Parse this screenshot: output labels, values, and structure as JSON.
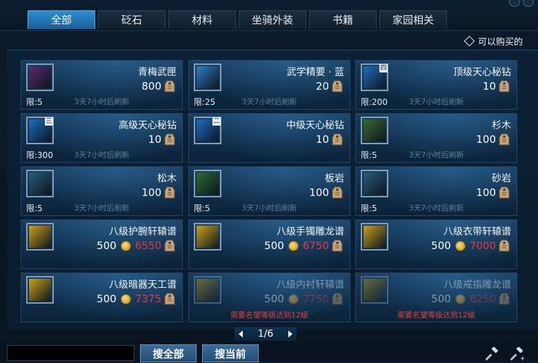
{
  "tabs": [
    "全部",
    "砭石",
    "材料",
    "坐骑外装",
    "书籍",
    "家园相关"
  ],
  "filter_label": "可以购买的",
  "pager": "1/6",
  "buttons": {
    "search_all": "搜全部",
    "search_current": "搜当前"
  },
  "items": [
    {
      "name": "青梅武匣",
      "price": "800",
      "limit": "限:5",
      "refresh": "3天7小时后刷新",
      "icon": "box-icon",
      "color": "#5b2b6e",
      "badge": ""
    },
    {
      "name": "武学精要 · 蓝",
      "price": "20",
      "limit": "限:25",
      "refresh": "3天7小时后刷新",
      "icon": "scroll-icon",
      "color": "#2f7fc4",
      "badge": ""
    },
    {
      "name": "顶级天心秘钻",
      "price": "10",
      "limit": "限:200",
      "refresh": "3天7小时后刷新",
      "icon": "gem-icon",
      "color": "#1e6ec0",
      "badge": "四"
    },
    {
      "name": "高级天心秘钻",
      "price": "10",
      "limit": "限:300",
      "refresh": "3天7小时后刷新",
      "icon": "gem-icon",
      "color": "#1e6ec0",
      "badge": "三"
    },
    {
      "name": "中级天心秘钻",
      "price": "10",
      "limit": "",
      "refresh": "",
      "icon": "gem-icon",
      "color": "#1e6ec0",
      "badge": "二"
    },
    {
      "name": "杉木",
      "price": "100",
      "limit": "限:5",
      "refresh": "3天7小时后刷新",
      "icon": "wood-icon",
      "color": "#3c6a2e",
      "badge": ""
    },
    {
      "name": "松木",
      "price": "100",
      "limit": "限:5",
      "refresh": "3天7小时后刷新",
      "icon": "wood-icon",
      "color": "#2a5d7c",
      "badge": ""
    },
    {
      "name": "板岩",
      "price": "100",
      "limit": "限:5",
      "refresh": "3天7小时后刷新",
      "icon": "stone-icon",
      "color": "#2e6a30",
      "badge": ""
    },
    {
      "name": "砂岩",
      "price": "100",
      "limit": "限:5",
      "refresh": "3天7小时后刷新",
      "icon": "stone-icon",
      "color": "#2a5d7c",
      "badge": ""
    },
    {
      "name": "八级护腕轩辕谱",
      "price": "500",
      "cost": "6550",
      "limit": "",
      "refresh": "",
      "icon": "book-icon",
      "color": "#c9a21a",
      "badge": ""
    },
    {
      "name": "八级手镯雕龙谱",
      "price": "500",
      "cost": "6750",
      "limit": "",
      "refresh": "",
      "icon": "book-icon",
      "color": "#c9a21a",
      "badge": ""
    },
    {
      "name": "八级衣带轩辕谱",
      "price": "500",
      "cost": "7000",
      "limit": "",
      "refresh": "",
      "icon": "book-icon",
      "color": "#c9a21a",
      "badge": ""
    },
    {
      "name": "八级暗器天工谱",
      "price": "500",
      "cost": "7375",
      "limit": "",
      "refresh": "",
      "icon": "book-icon",
      "color": "#c9a21a",
      "badge": ""
    },
    {
      "name": "八级内衬轩辕谱",
      "price": "500",
      "cost": "7750",
      "limit": "",
      "refresh": "",
      "icon": "book-icon",
      "color": "#c9a21a",
      "badge": "",
      "req": "需要名望等级达到12级",
      "dim": true
    },
    {
      "name": "八级戒指雕龙谱",
      "price": "500",
      "cost": "8250",
      "limit": "",
      "refresh": "",
      "icon": "book-icon",
      "color": "#c9a21a",
      "badge": "",
      "req": "需要名望等级达到12级",
      "dim": true
    }
  ]
}
